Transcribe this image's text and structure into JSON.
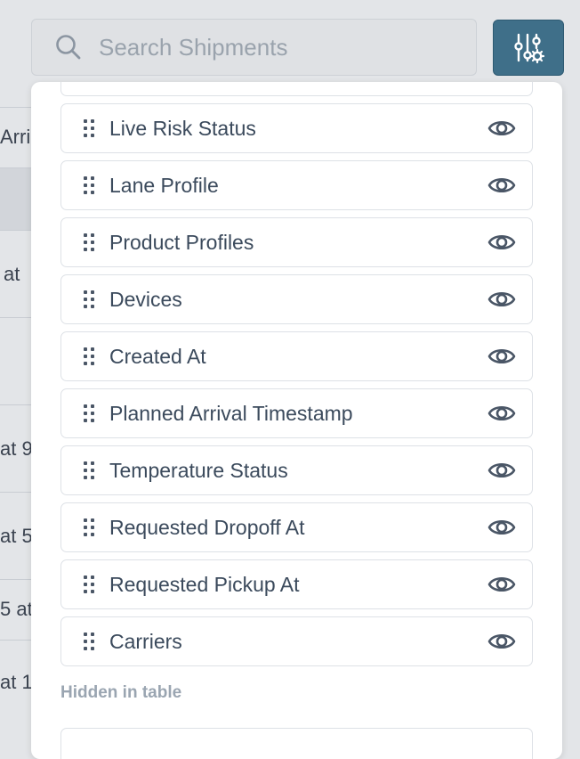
{
  "search": {
    "placeholder": "Search Shipments",
    "value": ""
  },
  "toolbar": {
    "settings_icon": "sliders-gear-icon",
    "accent": "#3f6f89"
  },
  "background_table": {
    "fragments": [
      "Arri",
      "at",
      "at 9",
      "at 5",
      "5 at",
      "at 1"
    ]
  },
  "columns_panel": {
    "visible_columns": [
      {
        "label": "Live Risk Status"
      },
      {
        "label": "Lane Profile"
      },
      {
        "label": "Product Profiles"
      },
      {
        "label": "Devices"
      },
      {
        "label": "Created At"
      },
      {
        "label": "Planned Arrival Timestamp"
      },
      {
        "label": "Temperature Status"
      },
      {
        "label": "Requested Dropoff At"
      },
      {
        "label": "Requested Pickup At"
      },
      {
        "label": "Carriers"
      }
    ],
    "hidden_section_label": "Hidden in table"
  }
}
